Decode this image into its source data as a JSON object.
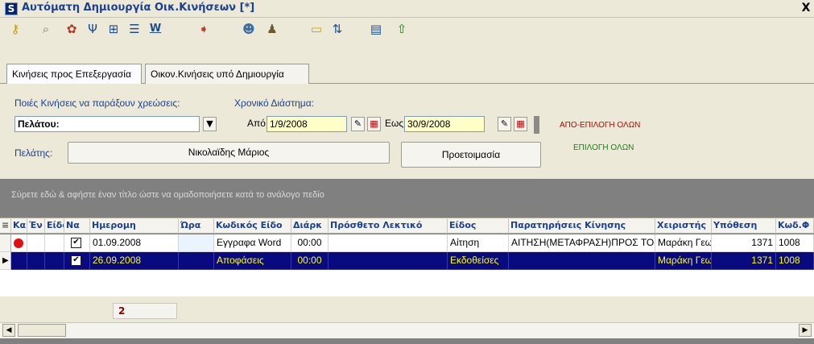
{
  "window": {
    "logo": "S",
    "title": "Αυτόματη Δημιουργία Οικ.Κινήσεων [*]",
    "close": "X"
  },
  "toolbar": {
    "icons": [
      "key-icon",
      "search-icon",
      "flower-icon",
      "tree-icon",
      "hierarchy-icon",
      "list-icon",
      "w-icon",
      "export-icon",
      "user-icon",
      "person-icon",
      "folder-icon",
      "sort-icon",
      "notes-icon",
      "up-arrow-icon"
    ]
  },
  "tabs": [
    {
      "label": "Κινήσεις προς Επεξεργασία"
    },
    {
      "label": "Οικον.Κινήσεις υπό Δημιουργία"
    }
  ],
  "form": {
    "charges_label": "Ποιές Κινήσεις να παράξουν χρεώσεις:",
    "charges_value": "Πελάτου:",
    "period_label": "Χρονικό Διάστημα:",
    "from_label": "Από",
    "from_value": "1/9/2008",
    "to_label": "Εως",
    "to_value": "30/9/2008",
    "deselect_all": "ΑΠΟ-ΕΠΙΛΟΓΗ ΟΛΩΝ",
    "select_all": "ΕΠΙΛΟΓΗ ΟΛΩΝ",
    "client_label": "Πελάτης:",
    "client_value": "Νικολαϊδης Μάριος",
    "prepare_button": "Προετοιμασία"
  },
  "grid": {
    "group_hint": "Σύρετε εδώ & αφήστε έναν τίτλο ώστε να ομαδοποιήσετε κατά το ανάλογο πεδίο",
    "columns": [
      "Κα",
      "Έν",
      "Είδο",
      "Να",
      "Ημερομη",
      "Ώρα",
      "Κωδικός Είδο",
      "Διάρκ",
      "Πρόσθετο Λεκτικό",
      "Είδος",
      "Παρατηρήσεις Κίνησης",
      "Χειριστής",
      "Υπόθεση",
      "Κωδ.Φ"
    ],
    "rows": [
      {
        "date": "01.09.2008",
        "time": "",
        "code": "Εγγραφα Word",
        "duration": "00:00",
        "extra": "",
        "type": "Αίτηση",
        "notes": "ΑΙΤΗΣΗ(ΜΕΤΑΦΡΑΣΗ)ΠΡΟΣ ΤΟ",
        "operator": "Μαράκη Γεω",
        "case": "1371",
        "cod": "1008",
        "checked": true,
        "red_dot": true
      },
      {
        "date": "26.09.2008",
        "time": "",
        "code": "Αποφάσεις",
        "duration": "00:00",
        "extra": "",
        "type": "Εκδοθείσες",
        "notes": "",
        "operator": "Μαράκη Γεω",
        "case": "1371",
        "cod": "1008",
        "checked": true,
        "red_dot": false
      }
    ],
    "count": "2"
  },
  "colors": {
    "selection": "#0a0a80",
    "field_bg": "#ffffc8",
    "accent": "#1b3f91"
  }
}
